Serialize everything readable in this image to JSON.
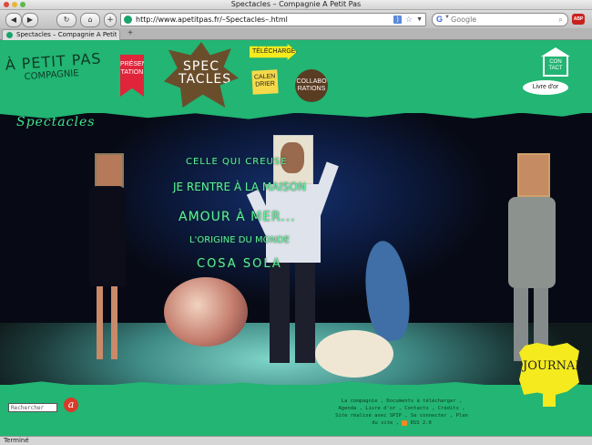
{
  "window": {
    "title": "Spectacles – Compagnie A Petit Pas"
  },
  "toolbar": {
    "back_label": "◀",
    "forward_label": "▶",
    "reload_label": "↻",
    "home_label": "⌂",
    "url": "http://www.apetitpas.fr/–Spectacles–.html",
    "search_placeholder": "Google"
  },
  "tabs": [
    {
      "label": "Spectacles – Compagnie A Petit Pas"
    }
  ],
  "site": {
    "logo_line1": "À PETIT PAS",
    "logo_line2": "COMPAGNIE",
    "menu": {
      "presentation": "PRÉSEN TATION",
      "spectacles": "SPEC TACLES",
      "telecharger": "TÉLÉCHARGER",
      "calendrier": "CALEN DRIER",
      "collaborations": "COLLABO RATIONS",
      "contact": "CON TACT",
      "livredor": "Livre d'or"
    },
    "section_title": "Spectacles",
    "shows": [
      "Celle qui creuse",
      "Je rentre à la maison",
      "Amour à mer...",
      "L'origine du monde",
      "Cosa sola"
    ],
    "journal": "JOURNAL",
    "search_placeholder": "Rechercher",
    "search_go": "a",
    "footer": {
      "line1": "La compagnie , Documents à télécharger ,",
      "line2": "Agenda , Livre d'or , Contacts , Crédits ,",
      "line3": "Site réalisé avec SPIP , Se connecter , Plan",
      "line4": "du site ,",
      "rss": "RSS 2.0"
    }
  },
  "status": {
    "text": "Terminé"
  },
  "colors": {
    "brand_green": "#22b573",
    "show_text": "#5ff09a",
    "journal_yellow": "#f4ea1e"
  }
}
